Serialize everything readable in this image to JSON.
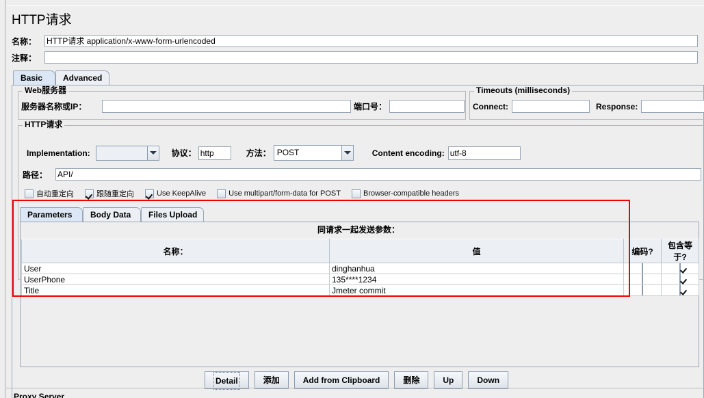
{
  "window": {
    "title": "HTTP请求"
  },
  "header": {
    "name_label": "名称：",
    "name_value": "HTTP请求  application/x-www-form-urlencoded",
    "comment_label": "注释：",
    "comment_value": ""
  },
  "tabs": [
    {
      "label": "Basic",
      "selected": true
    },
    {
      "label": "Advanced",
      "selected": false
    }
  ],
  "web_server": {
    "group_title": "Web服务器",
    "server_label": "服务器名称或IP：",
    "server_value": "",
    "port_label": "端口号：",
    "port_value": ""
  },
  "timeouts": {
    "group_title": "Timeouts (milliseconds)",
    "connect_label": "Connect:",
    "connect_value": "",
    "response_label": "Response:",
    "response_value": ""
  },
  "http_request": {
    "group_title": "HTTP请求",
    "implementation_label": "Implementation:",
    "implementation_value": "",
    "protocol_label": "协议：",
    "protocol_value": "http",
    "method_label": "方法：",
    "method_value": "POST",
    "content_encoding_label": "Content encoding:",
    "content_encoding_value": "utf-8",
    "path_label": "路径：",
    "path_value": "API/"
  },
  "options": [
    {
      "label": "自动重定向",
      "checked": false
    },
    {
      "label": "跟随重定向",
      "checked": true
    },
    {
      "label": "Use KeepAlive",
      "checked": true
    },
    {
      "label": "Use multipart/form-data for POST",
      "checked": false
    },
    {
      "label": "Browser-compatible headers",
      "checked": false
    }
  ],
  "inner_tabs": [
    {
      "label": "Parameters",
      "selected": true
    },
    {
      "label": "Body Data",
      "selected": false
    },
    {
      "label": "Files Upload",
      "selected": false
    }
  ],
  "parameters": {
    "send_with_request_label": "同请求一起发送参数：",
    "columns": [
      "名称：",
      "值",
      "编码?",
      "包含等于?"
    ],
    "rows": [
      {
        "name": "User",
        "value": "dinghanhua",
        "encode": false,
        "include_equals": true
      },
      {
        "name": "UserPhone",
        "value": "135****1234",
        "encode": false,
        "include_equals": true
      },
      {
        "name": "Title",
        "value": "Jmeter commit",
        "encode": false,
        "include_equals": true
      }
    ]
  },
  "buttons": [
    {
      "label": "Detail",
      "focused": true
    },
    {
      "label": "添加",
      "focused": false
    },
    {
      "label": "Add from Clipboard",
      "focused": false
    },
    {
      "label": "删除",
      "focused": false
    },
    {
      "label": "Up",
      "focused": false
    },
    {
      "label": "Down",
      "focused": false
    }
  ],
  "footer": {
    "proxy_group_title": "Proxy Server"
  },
  "annotation": {
    "highlight_color": "#f20000"
  }
}
